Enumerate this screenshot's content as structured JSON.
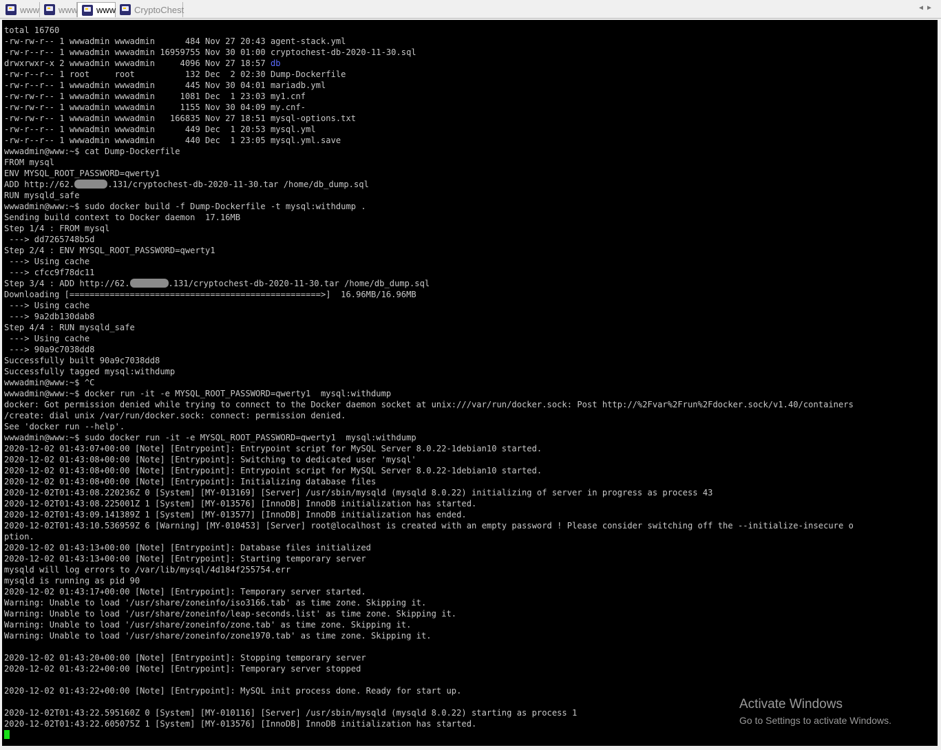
{
  "tabs": [
    {
      "label": "www",
      "active": false,
      "icon": "putty-terminal-icon"
    },
    {
      "label": "www",
      "active": false,
      "icon": "putty-terminal-icon"
    },
    {
      "label": "www",
      "active": true,
      "icon": "putty-terminal-icon"
    },
    {
      "label": "CryptoChest",
      "active": false,
      "icon": "putty-terminal-icon"
    }
  ],
  "tab_scroll": {
    "left": "◀",
    "right": "▶"
  },
  "terminal": {
    "lines": [
      "total 16760",
      "-rw-rw-r-- 1 wwwadmin wwwadmin      484 Nov 27 20:43 agent-stack.yml",
      "-rw-r--r-- 1 wwwadmin wwwadmin 16959755 Nov 30 01:00 cryptochest-db-2020-11-30.sql",
      "drwxrwxr-x 2 wwwadmin wwwadmin     4096 Nov 27 18:57 ",
      "-rw-r--r-- 1 root     root          132 Dec  2 02:30 Dump-Dockerfile",
      "-rw-r--r-- 1 wwwadmin wwwadmin      445 Nov 30 04:01 mariadb.yml",
      "-rw-rw-r-- 1 wwwadmin wwwadmin     1081 Dec  1 23:03 my1.cnf",
      "-rw-rw-r-- 1 wwwadmin wwwadmin     1155 Nov 30 04:09 my.cnf-",
      "-rw-rw-r-- 1 wwwadmin wwwadmin   166835 Nov 27 18:51 mysql-options.txt",
      "-rw-r--r-- 1 wwwadmin wwwadmin      449 Dec  1 20:53 mysql.yml",
      "-rw-r--r-- 1 wwwadmin wwwadmin      440 Dec  1 23:05 mysql.yml.save",
      "wwwadmin@www:~$ cat Dump-Dockerfile",
      "FROM mysql",
      "ENV MYSQL_ROOT_PASSWORD=qwerty1",
      "ADD http://62.",
      "RUN mysqld_safe",
      "wwwadmin@www:~$ sudo docker build -f Dump-Dockerfile -t mysql:withdump .",
      "Sending build context to Docker daemon  17.16MB",
      "Step 1/4 : FROM mysql",
      " ---> dd7265748b5d",
      "Step 2/4 : ENV MYSQL_ROOT_PASSWORD=qwerty1",
      " ---> Using cache",
      " ---> cfcc9f78dc11",
      "Step 3/4 : ADD http://62.",
      "Downloading [==================================================>]  16.96MB/16.96MB",
      " ---> Using cache",
      " ---> 9a2db130dab8",
      "Step 4/4 : RUN mysqld_safe",
      " ---> Using cache",
      " ---> 90a9c7038dd8",
      "Successfully built 90a9c7038dd8",
      "Successfully tagged mysql:withdump",
      "wwwadmin@www:~$ ^C",
      "wwwadmin@www:~$ docker run -it -e MYSQL_ROOT_PASSWORD=qwerty1  mysql:withdump",
      "docker: Got permission denied while trying to connect to the Docker daemon socket at unix:///var/run/docker.sock: Post http://%2Fvar%2Frun%2Fdocker.sock/v1.40/containers",
      "/create: dial unix /var/run/docker.sock: connect: permission denied.",
      "See 'docker run --help'.",
      "wwwadmin@www:~$ sudo docker run -it -e MYSQL_ROOT_PASSWORD=qwerty1  mysql:withdump",
      "2020-12-02 01:43:07+00:00 [Note] [Entrypoint]: Entrypoint script for MySQL Server 8.0.22-1debian10 started.",
      "2020-12-02 01:43:08+00:00 [Note] [Entrypoint]: Switching to dedicated user 'mysql'",
      "2020-12-02 01:43:08+00:00 [Note] [Entrypoint]: Entrypoint script for MySQL Server 8.0.22-1debian10 started.",
      "2020-12-02 01:43:08+00:00 [Note] [Entrypoint]: Initializing database files",
      "2020-12-02T01:43:08.220236Z 0 [System] [MY-013169] [Server] /usr/sbin/mysqld (mysqld 8.0.22) initializing of server in progress as process 43",
      "2020-12-02T01:43:08.225001Z 1 [System] [MY-013576] [InnoDB] InnoDB initialization has started.",
      "2020-12-02T01:43:09.141389Z 1 [System] [MY-013577] [InnoDB] InnoDB initialization has ended.",
      "2020-12-02T01:43:10.536959Z 6 [Warning] [MY-010453] [Server] root@localhost is created with an empty password ! Please consider switching off the --initialize-insecure o",
      "ption.",
      "2020-12-02 01:43:13+00:00 [Note] [Entrypoint]: Database files initialized",
      "2020-12-02 01:43:13+00:00 [Note] [Entrypoint]: Starting temporary server",
      "mysqld will log errors to /var/lib/mysql/4d184f255754.err",
      "mysqld is running as pid 90",
      "2020-12-02 01:43:17+00:00 [Note] [Entrypoint]: Temporary server started.",
      "Warning: Unable to load '/usr/share/zoneinfo/iso3166.tab' as time zone. Skipping it.",
      "Warning: Unable to load '/usr/share/zoneinfo/leap-seconds.list' as time zone. Skipping it.",
      "Warning: Unable to load '/usr/share/zoneinfo/zone.tab' as time zone. Skipping it.",
      "Warning: Unable to load '/usr/share/zoneinfo/zone1970.tab' as time zone. Skipping it.",
      "",
      "2020-12-02 01:43:20+00:00 [Note] [Entrypoint]: Stopping temporary server",
      "2020-12-02 01:43:22+00:00 [Note] [Entrypoint]: Temporary server stopped",
      "",
      "2020-12-02 01:43:22+00:00 [Note] [Entrypoint]: MySQL init process done. Ready for start up.",
      "",
      "2020-12-02T01:43:22.595160Z 0 [System] [MY-010116] [Server] /usr/sbin/mysqld (mysqld 8.0.22) starting as process 1",
      "2020-12-02T01:43:22.605075Z 1 [System] [MY-013576] [InnoDB] InnoDB initialization has started."
    ],
    "dir_name": "db",
    "add_line_tail": ".131/cryptochest-db-2020-11-30.tar /home/db_dump.sql",
    "colors": {
      "background": "#000000",
      "text": "#c8c8c8",
      "directory": "#5a6bff",
      "cursor": "#18e018"
    }
  },
  "watermark": {
    "title": "Activate Windows",
    "subtitle": "Go to Settings to activate Windows."
  }
}
